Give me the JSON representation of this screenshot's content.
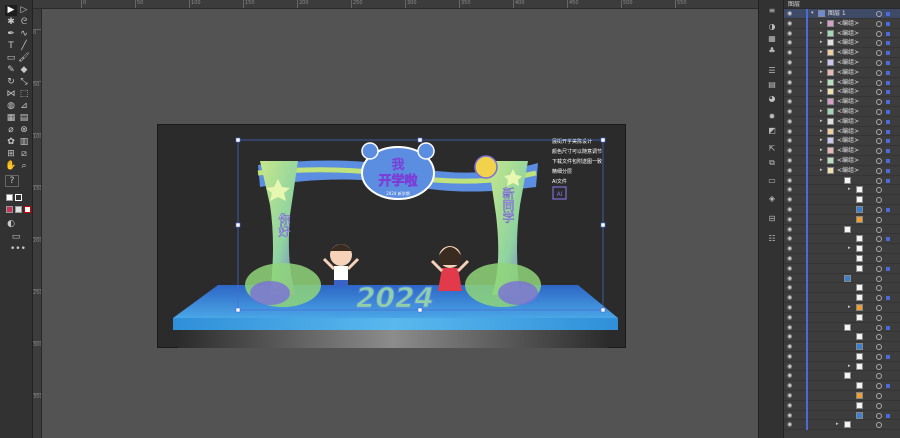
{
  "layers_panel": {
    "tab": "图层",
    "top_layer_name": "图层 1",
    "group_label": "<编组>",
    "group_count": 16,
    "subrow_count": 26
  },
  "artwork": {
    "title_line1": "我",
    "title_line2": "开学啦",
    "title_sub": "2024 新学期",
    "left_pillar_text": "你好",
    "right_pillar_text": "新同学",
    "year": "2024",
    "notes": [
      "展街开学美陈设计",
      "颜色尺寸可以随意调节",
      "下载文件包附送图一致",
      "精细分层",
      "AI文件"
    ],
    "ai_badge": "AI"
  },
  "colors": {
    "accent": "#4b6bd6",
    "stage_blue": "#3a7fd0",
    "arch_green": "#bfe27a",
    "arch_purple": "#7b6fd8"
  },
  "toolbar": {
    "help": "?",
    "more": "•••"
  },
  "ruler": {
    "top_ticks": [
      "0",
      "50",
      "100",
      "150",
      "200",
      "250",
      "300",
      "350",
      "400",
      "450",
      "500",
      "550"
    ],
    "left_ticks": [
      "0",
      "50",
      "100",
      "150",
      "200",
      "250",
      "300",
      "350"
    ]
  }
}
